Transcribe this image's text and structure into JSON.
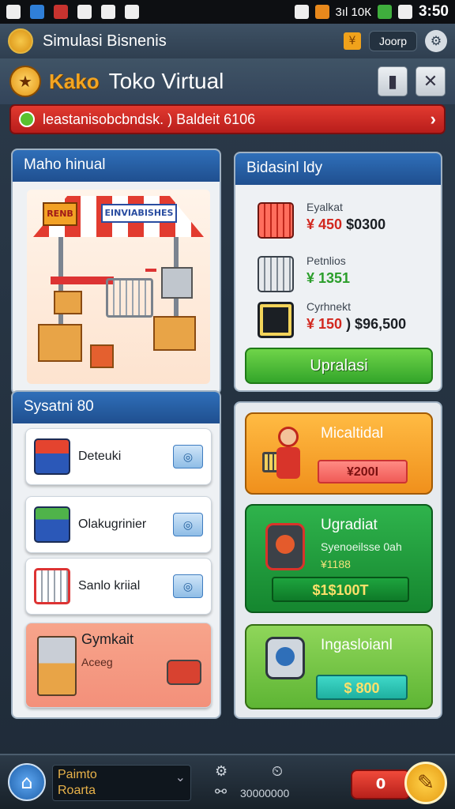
{
  "status_bar": {
    "time": "3:50",
    "signal_text": "3ıl 10К",
    "left_icons": [
      "a-icon",
      "browser-icon",
      "news-icon",
      "photo-icon",
      "clock-icon",
      "app-icon"
    ],
    "right_icons": [
      "alarm-icon",
      "notification-icon",
      "wifi-icon",
      "signal-icon"
    ]
  },
  "app_bar": {
    "title": "Simulasi Bisnenis",
    "user_label": "Joorp",
    "badge": "¥"
  },
  "title_bar": {
    "brand": "Kako",
    "name": "Toko Virtual"
  },
  "banner": {
    "text": "leastanisobcbndsk. ) Baldeit 6106"
  },
  "left_top_panel": {
    "title": "Maho hinual",
    "sign_main": "EINVIABISHES",
    "sign_small": "RENB"
  },
  "left_bottom_panel": {
    "title": "Sysatni 80",
    "items": [
      {
        "label": "Deteuki"
      },
      {
        "label": "Olakugrinier"
      },
      {
        "label": "Sanlo kriial"
      }
    ],
    "special": {
      "label": "Gymkait",
      "sub": "Aceeg"
    }
  },
  "right_top_panel": {
    "title": "Bidasinl ldy",
    "products": [
      {
        "name": "Eyalkat",
        "price_a": "¥ 450",
        "price_b": "$0300"
      },
      {
        "name": "Petnlios",
        "price_a": "¥ 1351",
        "price_b": ""
      },
      {
        "name": "Cyrhnekt",
        "price_a": "¥ 150",
        "price_b": ") $96,500"
      }
    ],
    "button": "Upralasi"
  },
  "right_bottom_panel": {
    "cards": [
      {
        "title": "Micaltidal",
        "price": "¥200I"
      },
      {
        "title": "Ugradiat",
        "sub1": "Syenoeilsse 0ah",
        "sub2": "¥1188",
        "price": "$1$100T"
      },
      {
        "title": "Ingasloianl",
        "price": "$ 800"
      }
    ]
  },
  "bottom_bar": {
    "text_line1": "Paimto",
    "text_line2": "Roarta",
    "mid_text": "30000000",
    "red_button": "0"
  }
}
